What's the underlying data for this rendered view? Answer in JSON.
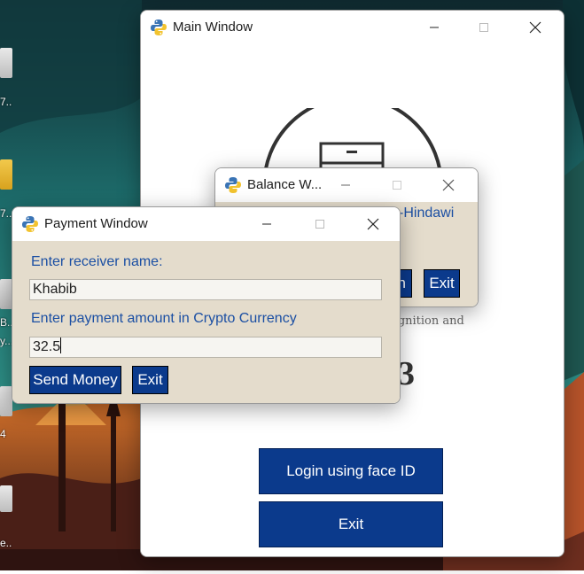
{
  "desktop": {
    "icon_labels": [
      "7...",
      "7...",
      "B...",
      "y...",
      "4",
      "e..."
    ]
  },
  "main_window": {
    "title": "Main Window",
    "subtitle_fragment": "ognition and",
    "number_fragment": "3",
    "login_label": "Login using face ID",
    "exit_label": "Exit"
  },
  "balance_window": {
    "title": "Balance W...",
    "name_fragment": "-Hindawi",
    "button_fragment": "h",
    "exit_label": "Exit"
  },
  "payment_window": {
    "title": "Payment Window",
    "receiver_label": "Enter receiver name:",
    "receiver_value": "Khabib",
    "amount_label": "Enter payment amount in Crypto Currency",
    "amount_value": "32.5",
    "send_label": "Send Money",
    "exit_label": "Exit"
  },
  "icons": {
    "app": "python-icon",
    "minimize": "minimize-icon",
    "maximize": "maximize-icon",
    "close": "close-icon",
    "illustration": "safe-illustration-icon"
  },
  "colors": {
    "button_blue": "#0b3a8c",
    "label_blue": "#1b4fa3",
    "tk_background": "#e4dccc"
  }
}
